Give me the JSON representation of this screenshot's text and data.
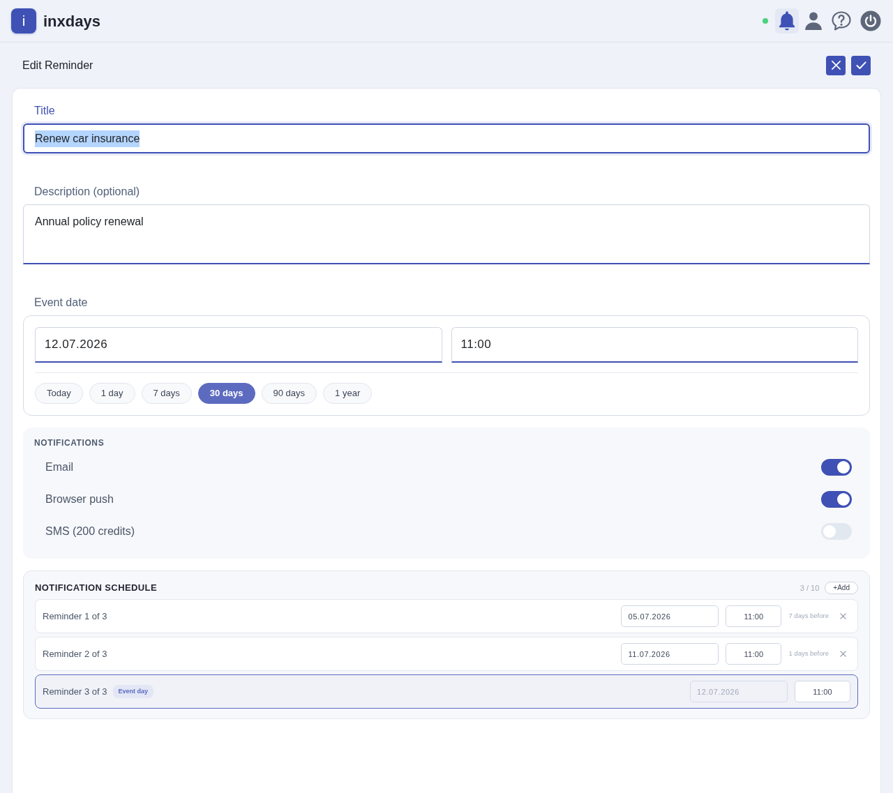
{
  "header": {
    "logo_letter": "i",
    "app_name": "inxdays",
    "online": true,
    "buttons": [
      {
        "kind": "notifications",
        "selected": true
      },
      {
        "kind": "profile",
        "selected": false
      },
      {
        "kind": "help",
        "selected": false
      },
      {
        "kind": "power",
        "selected": false
      }
    ]
  },
  "page": {
    "title": "Edit Reminder",
    "actions": [
      {
        "kind": "cancel"
      },
      {
        "kind": "save"
      }
    ]
  },
  "form": {
    "title": {
      "label": "Title",
      "value": "Renew car insurance",
      "focused": true,
      "text_selected": true
    },
    "description": {
      "label": "Description (optional)",
      "value": "Annual policy renewal"
    },
    "event_date": {
      "label": "Event date",
      "date": "12.07.2026",
      "time": "11:00",
      "presets": [
        {
          "label": "Today",
          "selected": false
        },
        {
          "label": "1 day",
          "selected": false
        },
        {
          "label": "7 days",
          "selected": false
        },
        {
          "label": "30 days",
          "selected": true
        },
        {
          "label": "90 days",
          "selected": false
        },
        {
          "label": "1 year",
          "selected": false
        }
      ]
    }
  },
  "notifications": {
    "heading": "NOTIFICATIONS",
    "channels": [
      {
        "label": "Email",
        "on": true
      },
      {
        "label": "Browser push",
        "on": true
      },
      {
        "label": "SMS (200 credits)",
        "on": false
      }
    ]
  },
  "schedule": {
    "heading": "NOTIFICATION SCHEDULE",
    "count": "3 / 10",
    "add_label": "+Add",
    "reminders": [
      {
        "label": "Reminder 1 of 3",
        "date": "05.07.2026",
        "date_disabled": false,
        "time": "11:00",
        "offset": "7 days before",
        "removable": true,
        "selected": false
      },
      {
        "label": "Reminder 2 of 3",
        "date": "11.07.2026",
        "date_disabled": false,
        "time": "11:00",
        "offset": "1 days before",
        "removable": true,
        "selected": false
      },
      {
        "label": "Reminder 3 of 3",
        "tag": "Event day",
        "date": "12.07.2026",
        "date_disabled": true,
        "time": "11:00",
        "removable": false,
        "selected": true
      }
    ]
  }
}
